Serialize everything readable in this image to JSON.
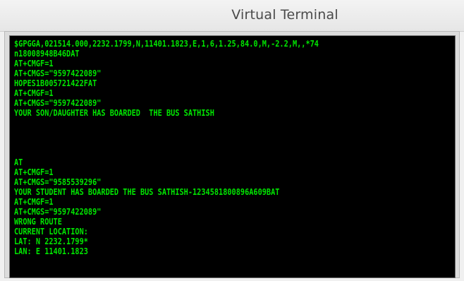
{
  "window": {
    "title": "Virtual Terminal"
  },
  "terminal": {
    "lines": [
      "$GPGGA,021514.000,2232.1799,N,11401.1823,E,1,6,1.25,84.0,M,-2.2,M,,*74",
      "n18008948B46DAT",
      "AT+CMGF=1",
      "AT+CMGS=\"9597422089\"",
      "HOPES1B005721422FAT",
      "AT+CMGF=1",
      "AT+CMGS=\"9597422089\"",
      "YOUR SON/DAUGHTER HAS BOARDED  THE BUS SATHISH",
      "",
      "",
      "AT",
      "AT+CMGF=1",
      "AT+CMGS=\"9585539296\"",
      "YOUR STUDENT HAS BOARDED THE BUS SATHISH-1234581800896A609BAT",
      "AT+CMGF=1",
      "AT+CMGS=\"9597422089\"",
      "WRONG ROUTE",
      "CURRENT LOCATION:",
      "LAT: N 2232.1799*",
      "LAN: E 11401.1823"
    ]
  },
  "colors": {
    "terminal_bg": "#000000",
    "terminal_text": "#00e400",
    "titlebar_bg": "#ececec"
  }
}
